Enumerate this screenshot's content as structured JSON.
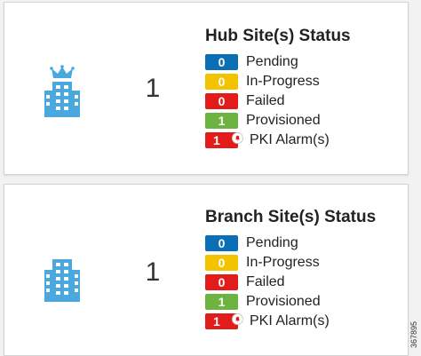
{
  "hub": {
    "title": "Hub Site(s) Status",
    "count": "1",
    "icon": "hub-building-crown-icon",
    "statuses": [
      {
        "value": "0",
        "label": "Pending"
      },
      {
        "value": "0",
        "label": "In-Progress"
      },
      {
        "value": "0",
        "label": "Failed"
      },
      {
        "value": "1",
        "label": "Provisioned"
      },
      {
        "value": "1",
        "label": "PKI Alarm(s)"
      }
    ]
  },
  "branch": {
    "title": "Branch Site(s) Status",
    "count": "1",
    "icon": "branch-building-icon",
    "statuses": [
      {
        "value": "0",
        "label": "Pending"
      },
      {
        "value": "0",
        "label": "In-Progress"
      },
      {
        "value": "0",
        "label": "Failed"
      },
      {
        "value": "1",
        "label": "Provisioned"
      },
      {
        "value": "1",
        "label": "PKI Alarm(s)"
      }
    ]
  },
  "colors": {
    "pending": "#0a6fb4",
    "in_progress": "#f3c300",
    "failed": "#e21b1b",
    "provisioned": "#6db33f",
    "pki_alarm": "#e21b1b",
    "icon": "#4aa8de"
  },
  "figure_id": "367895"
}
